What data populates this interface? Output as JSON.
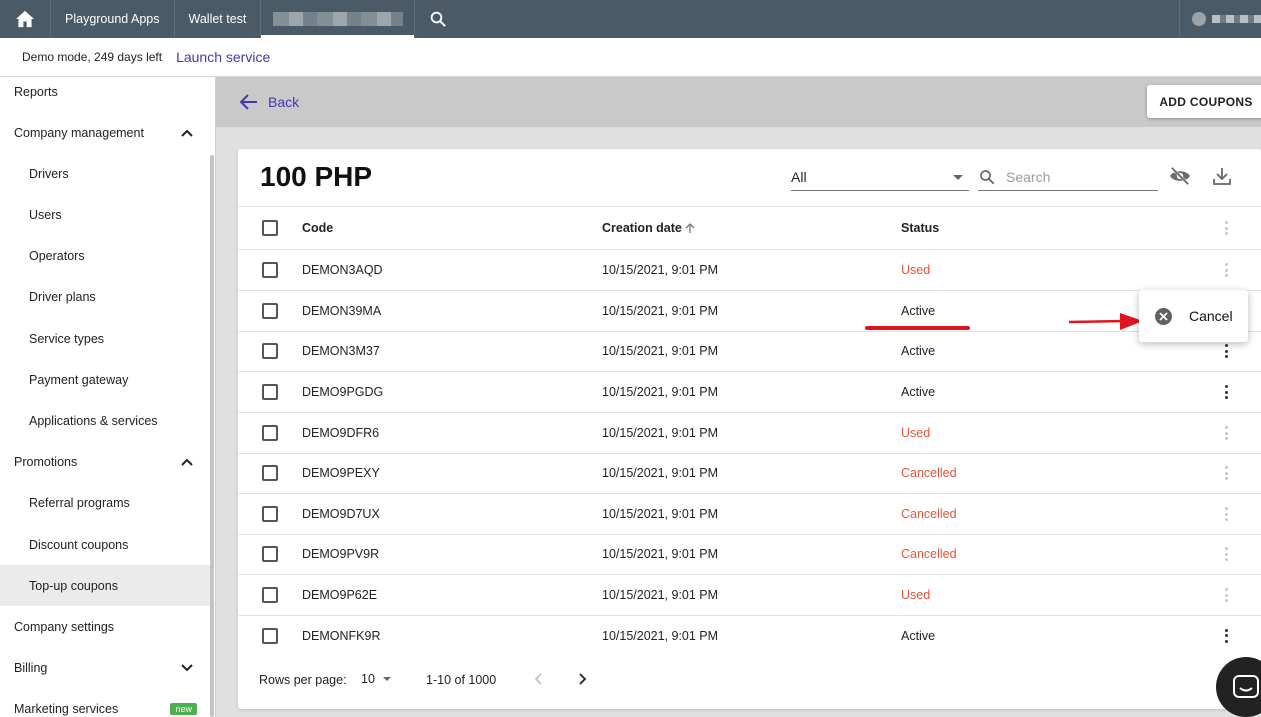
{
  "topbar": {
    "tabs": [
      "Playground Apps",
      "Wallet test"
    ],
    "home_icon": "home-icon",
    "search_icon": "search-icon"
  },
  "demobar": {
    "demo_text": "Demo mode, 249 days left",
    "launch_label": "Launch service"
  },
  "sidebar": {
    "items": [
      {
        "label": "Reports"
      },
      {
        "label": "Company management"
      },
      {
        "label": "Drivers"
      },
      {
        "label": "Users"
      },
      {
        "label": "Operators"
      },
      {
        "label": "Driver plans"
      },
      {
        "label": "Service types"
      },
      {
        "label": "Payment gateway"
      },
      {
        "label": "Applications & services"
      },
      {
        "label": "Promotions"
      },
      {
        "label": "Referral programs"
      },
      {
        "label": "Discount coupons"
      },
      {
        "label": "Top-up coupons"
      },
      {
        "label": "Company settings"
      },
      {
        "label": "Billing"
      },
      {
        "label": "Marketing services",
        "badge": "new"
      }
    ]
  },
  "header": {
    "back_label": "Back",
    "add_coupons_label": "ADD COUPONS"
  },
  "card": {
    "title": "100 PHP",
    "filter_value": "All",
    "search_placeholder": "Search"
  },
  "table": {
    "columns": {
      "code": "Code",
      "date": "Creation date",
      "status": "Status"
    },
    "rows": [
      {
        "code": "DEMON3AQD",
        "date": "10/15/2021, 9:01 PM",
        "status": "Used"
      },
      {
        "code": "DEMON39MA",
        "date": "10/15/2021, 9:01 PM",
        "status": "Active"
      },
      {
        "code": "DEMON3M37",
        "date": "10/15/2021, 9:01 PM",
        "status": "Active"
      },
      {
        "code": "DEMO9PGDG",
        "date": "10/15/2021, 9:01 PM",
        "status": "Active"
      },
      {
        "code": "DEMO9DFR6",
        "date": "10/15/2021, 9:01 PM",
        "status": "Used"
      },
      {
        "code": "DEMO9PEXY",
        "date": "10/15/2021, 9:01 PM",
        "status": "Cancelled"
      },
      {
        "code": "DEMO9D7UX",
        "date": "10/15/2021, 9:01 PM",
        "status": "Cancelled"
      },
      {
        "code": "DEMO9PV9R",
        "date": "10/15/2021, 9:01 PM",
        "status": "Cancelled"
      },
      {
        "code": "DEMO9P62E",
        "date": "10/15/2021, 9:01 PM",
        "status": "Used"
      },
      {
        "code": "DEMONFK9R",
        "date": "10/15/2021, 9:01 PM",
        "status": "Active"
      }
    ]
  },
  "pagination": {
    "rows_per_page_label": "Rows per page:",
    "rows_per_page_value": "10",
    "range": "1-10 of 1000"
  },
  "popup": {
    "cancel_label": "Cancel"
  },
  "colors": {
    "accent": "#3f3ab3",
    "topbar": "#4a5a66",
    "status_red": "#e5533d",
    "annotation_red": "#e0141e"
  }
}
